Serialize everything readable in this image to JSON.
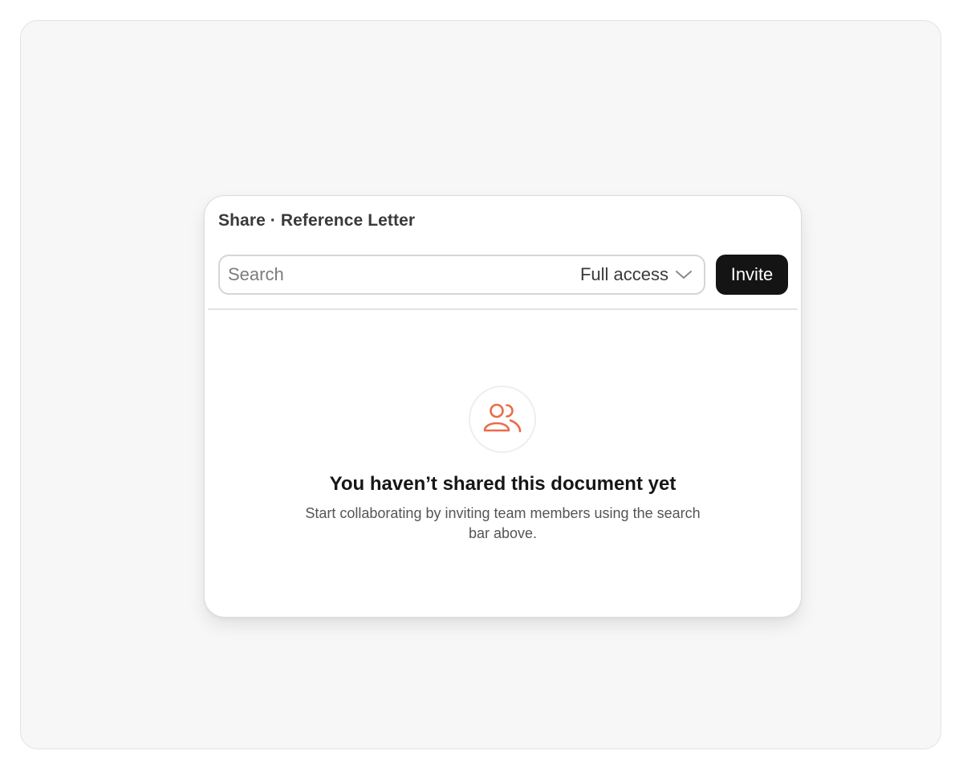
{
  "dialog": {
    "title": "Share · Reference Letter"
  },
  "search": {
    "placeholder": "Search",
    "value": "",
    "icon": "chevron-down-icon"
  },
  "access": {
    "selected": "Full access"
  },
  "invite": {
    "label": "Invite"
  },
  "empty_state": {
    "icon": "users-icon",
    "icon_color": "#ec6a4a",
    "title": "You haven’t shared this document yet",
    "description": "Start collaborating by inviting team members using the search bar above."
  },
  "colors": {
    "primary_button": "#141414",
    "accent": "#ec6a4a"
  }
}
